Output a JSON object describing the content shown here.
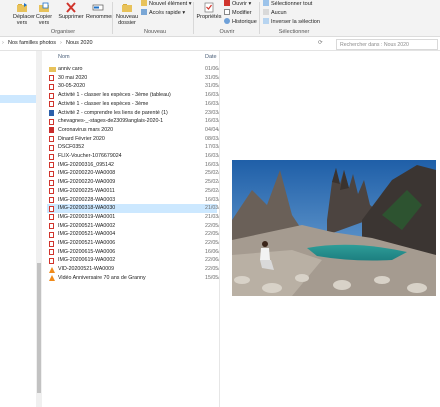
{
  "ribbon": {
    "move_to": "Déplacer vers",
    "copy_to": "Copier vers",
    "delete": "Supprimer",
    "rename": "Renommer",
    "new_folder": "Nouveau dossier",
    "new_item": "Nouvel élément",
    "easy_access": "Accès rapide",
    "properties": "Propriétés",
    "open": "Ouvrir",
    "edit": "Modifier",
    "history": "Historique",
    "select_all": "Sélectionner tout",
    "select_none": "Aucun",
    "invert_selection": "Inverser la sélection",
    "groups": [
      "Organiser",
      "Nouveau",
      "Ouvrir",
      "Sélectionner"
    ]
  },
  "address": {
    "crumbs": [
      "Nos familles photos",
      "Nous 2020"
    ],
    "search_placeholder": "Rechercher dans : Nous 2020"
  },
  "list": {
    "col_name": "Nom",
    "col_date": "Date",
    "files": [
      {
        "name": "anniv caro",
        "date": "01/06/",
        "type": "folder"
      },
      {
        "name": "30 mai 2020",
        "date": "31/05/",
        "type": "img"
      },
      {
        "name": "30-05-2020",
        "date": "31/05/",
        "type": "img"
      },
      {
        "name": "Activité 1 - classer les espèces - 3ème (tableau)",
        "date": "16/03/",
        "type": "img"
      },
      {
        "name": "Activité 1 - classer les espèces - 3ème",
        "date": "16/03/",
        "type": "img"
      },
      {
        "name": "Activité 2 - comprendre les liens de parenté (1)",
        "date": "23/03/",
        "type": "word"
      },
      {
        "name": "chevagnes-_-stages-de23099anglais-2020-1",
        "date": "16/03/",
        "type": "img"
      },
      {
        "name": "Coronavirus mars 2020",
        "date": "04/04/",
        "type": "pdf"
      },
      {
        "name": "Dinard Février 2020",
        "date": "08/03/",
        "type": "img"
      },
      {
        "name": "DSCF0352",
        "date": "17/03/",
        "type": "img"
      },
      {
        "name": "FLIX-Voucher-1076679024",
        "date": "16/03/",
        "type": "img"
      },
      {
        "name": "IMG-20200316_095142",
        "date": "16/03/",
        "type": "img"
      },
      {
        "name": "IMG-20200220-WA0008",
        "date": "25/02/",
        "type": "img"
      },
      {
        "name": "IMG-20200220-WA0009",
        "date": "25/02/",
        "type": "img"
      },
      {
        "name": "IMG-20200225-WA0011",
        "date": "25/02/",
        "type": "img"
      },
      {
        "name": "IMG-20200228-WA0003",
        "date": "16/03/",
        "type": "img"
      },
      {
        "name": "IMG-20200318-WA0030",
        "date": "21/03/",
        "type": "img",
        "selected": true
      },
      {
        "name": "IMG-20200319-WA0001",
        "date": "21/03/",
        "type": "img"
      },
      {
        "name": "IMG-20200521-WA0002",
        "date": "22/05/",
        "type": "img"
      },
      {
        "name": "IMG-20200521-WA0004",
        "date": "22/05/",
        "type": "img"
      },
      {
        "name": "IMG-20200521-WA0006",
        "date": "22/05/",
        "type": "img"
      },
      {
        "name": "IMG-20200615-WA0006",
        "date": "16/06/",
        "type": "img"
      },
      {
        "name": "IMG-20200619-WA0002",
        "date": "22/06/",
        "type": "img"
      },
      {
        "name": "VID-20200521-WA0009",
        "date": "22/05/",
        "type": "vlc"
      },
      {
        "name": "Vidéo Anniversaire 70 ans de Granny",
        "date": "15/05/",
        "type": "vlc"
      }
    ]
  },
  "colors": {
    "selection": "#cce8ff",
    "accent": "#0078d7"
  }
}
